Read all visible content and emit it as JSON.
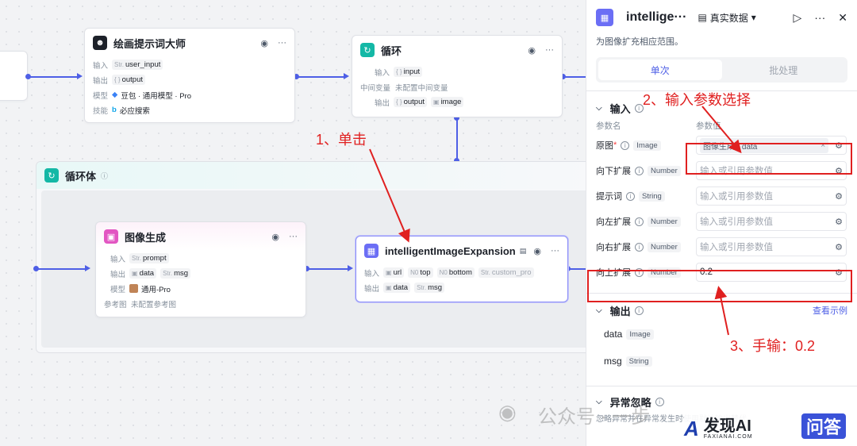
{
  "canvas": {
    "prompt_master": {
      "title": "绘画提示词大师",
      "input_label": "输入",
      "input_type": "Str.",
      "input_value": "user_input",
      "output_label": "输出",
      "output_type": "{ }",
      "output_value": "output",
      "model_label": "模型",
      "model_value": "豆包 · 通用模型 · Pro",
      "skill_label": "技能",
      "skill_value": "必应搜索"
    },
    "loop": {
      "title": "循环",
      "input_label": "输入",
      "input_type": "{ }",
      "input_value": "input",
      "mid_label": "中间变量",
      "mid_value": "未配置中间变量",
      "output_label": "输出",
      "output_value_1": "output",
      "output_value_2": "image"
    },
    "loop_body": {
      "title": "循环体"
    },
    "image_gen": {
      "title": "图像生成",
      "input_label": "输入",
      "input_type": "Str.",
      "input_value": "prompt",
      "output_label": "输出",
      "output_value_1": "data",
      "output_type_2": "Str.",
      "output_value_2": "msg",
      "model_label": "模型",
      "model_value": "通用-Pro",
      "ref_label": "参考图",
      "ref_value": "未配置参考图"
    },
    "expansion": {
      "title": "intelligentImageExpansion",
      "input_label": "输入",
      "in_1": "url",
      "in_2_type": "N0",
      "in_2": "top",
      "in_3_type": "N0",
      "in_3": "bottom",
      "in_4_type": "Str.",
      "in_4": "custom_pro",
      "output_label": "输出",
      "out_1": "data",
      "out_2_type": "Str.",
      "out_2": "msg"
    }
  },
  "panel": {
    "title": "intellige···",
    "data_mode": "真实数据",
    "description": "为图像扩充相应范围。",
    "tabs": [
      {
        "label": "单次"
      },
      {
        "label": "批处理"
      }
    ],
    "input_section": "输入",
    "col_name": "参数名",
    "col_value": "参数值",
    "params": [
      {
        "name": "原图",
        "required": "*",
        "type": "Image",
        "value": "",
        "chip": "图像生成 - data",
        "placeholder": ""
      },
      {
        "name": "向下扩展",
        "required": "",
        "type": "Number",
        "value": "",
        "chip": "",
        "placeholder": "输入或引用参数值"
      },
      {
        "name": "提示词",
        "required": "",
        "type": "String",
        "value": "",
        "chip": "",
        "placeholder": "输入或引用参数值"
      },
      {
        "name": "向左扩展",
        "required": "",
        "type": "Number",
        "value": "",
        "chip": "",
        "placeholder": "输入或引用参数值"
      },
      {
        "name": "向右扩展",
        "required": "",
        "type": "Number",
        "value": "",
        "chip": "",
        "placeholder": "输入或引用参数值"
      },
      {
        "name": "向上扩展",
        "required": "",
        "type": "Number",
        "value": "0.2",
        "chip": "",
        "placeholder": ""
      }
    ],
    "output_section": "输出",
    "view_example": "查看示例",
    "outputs": [
      {
        "name": "data",
        "type": "Image"
      },
      {
        "name": "msg",
        "type": "String"
      }
    ],
    "error_section": "异常忽略",
    "error_desc": "忽略异常并在异常发生时使用默认输出替代"
  },
  "annotations": {
    "step1": "1、单击",
    "step2": "2、输入参数选择",
    "step3": "3、手输：0.2"
  },
  "watermark": {
    "text": "公众号 · 一步",
    "brand": "发现AI",
    "brand_sub": "FAXIANAI.COM",
    "badge": "问答"
  },
  "colors": {
    "accent": "#4e5fe6",
    "annotation_red": "#e02020",
    "loop_teal": "#14b8a6",
    "image_pink": "#e255c2",
    "expansion_purple": "#6b6ef5"
  }
}
